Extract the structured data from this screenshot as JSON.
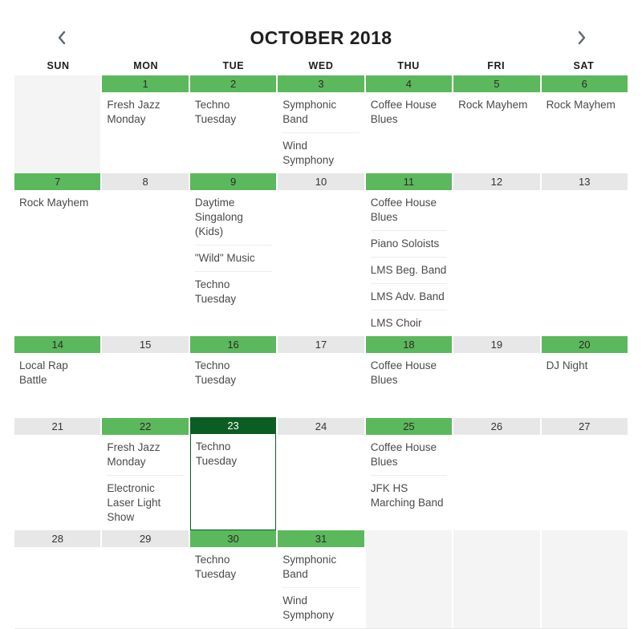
{
  "header": {
    "title": "OCTOBER 2018",
    "prev_label": "‹",
    "next_label": "›",
    "prev_icon": "chevron-left-icon",
    "next_icon": "chevron-right-icon"
  },
  "weekdays": [
    "SUN",
    "MON",
    "TUE",
    "WED",
    "THU",
    "FRI",
    "SAT"
  ],
  "colors": {
    "event_day": "#5cb85c",
    "today": "#0b5d23",
    "empty_day": "#e7e7e7",
    "outside_cell": "#f4f4f4",
    "text": "#4a4a4a"
  },
  "weeks": [
    {
      "days": [
        {
          "num": "",
          "outside": true,
          "today": false,
          "events": []
        },
        {
          "num": "1",
          "outside": false,
          "today": false,
          "events": [
            "Fresh Jazz Monday"
          ]
        },
        {
          "num": "2",
          "outside": false,
          "today": false,
          "events": [
            "Techno Tuesday"
          ]
        },
        {
          "num": "3",
          "outside": false,
          "today": false,
          "events": [
            "Symphonic Band",
            "Wind Symphony"
          ]
        },
        {
          "num": "4",
          "outside": false,
          "today": false,
          "events": [
            "Coffee House Blues"
          ]
        },
        {
          "num": "5",
          "outside": false,
          "today": false,
          "events": [
            "Rock Mayhem"
          ]
        },
        {
          "num": "6",
          "outside": false,
          "today": false,
          "events": [
            "Rock Mayhem"
          ]
        }
      ]
    },
    {
      "days": [
        {
          "num": "7",
          "outside": false,
          "today": false,
          "events": [
            "Rock Mayhem"
          ]
        },
        {
          "num": "8",
          "outside": false,
          "today": false,
          "events": []
        },
        {
          "num": "9",
          "outside": false,
          "today": false,
          "events": [
            "Daytime Singalong (Kids)",
            "\"Wild\" Music",
            "Techno Tuesday"
          ]
        },
        {
          "num": "10",
          "outside": false,
          "today": false,
          "events": []
        },
        {
          "num": "11",
          "outside": false,
          "today": false,
          "events": [
            "Coffee House Blues",
            "Piano Soloists",
            "LMS Beg. Band",
            "LMS Adv. Band",
            "LMS Choir"
          ]
        },
        {
          "num": "12",
          "outside": false,
          "today": false,
          "events": []
        },
        {
          "num": "13",
          "outside": false,
          "today": false,
          "events": []
        }
      ]
    },
    {
      "days": [
        {
          "num": "14",
          "outside": false,
          "today": false,
          "events": [
            "Local Rap Battle"
          ]
        },
        {
          "num": "15",
          "outside": false,
          "today": false,
          "events": []
        },
        {
          "num": "16",
          "outside": false,
          "today": false,
          "events": [
            "Techno Tuesday"
          ]
        },
        {
          "num": "17",
          "outside": false,
          "today": false,
          "events": []
        },
        {
          "num": "18",
          "outside": false,
          "today": false,
          "events": [
            "Coffee House Blues"
          ]
        },
        {
          "num": "19",
          "outside": false,
          "today": false,
          "events": []
        },
        {
          "num": "20",
          "outside": false,
          "today": false,
          "events": [
            "DJ Night"
          ]
        }
      ]
    },
    {
      "days": [
        {
          "num": "21",
          "outside": false,
          "today": false,
          "events": []
        },
        {
          "num": "22",
          "outside": false,
          "today": false,
          "events": [
            "Fresh Jazz Monday",
            "Electronic Laser Light Show"
          ]
        },
        {
          "num": "23",
          "outside": false,
          "today": true,
          "events": [
            "Techno Tuesday"
          ]
        },
        {
          "num": "24",
          "outside": false,
          "today": false,
          "events": []
        },
        {
          "num": "25",
          "outside": false,
          "today": false,
          "events": [
            "Coffee House Blues",
            "JFK HS Marching Band"
          ]
        },
        {
          "num": "26",
          "outside": false,
          "today": false,
          "events": []
        },
        {
          "num": "27",
          "outside": false,
          "today": false,
          "events": []
        }
      ]
    },
    {
      "days": [
        {
          "num": "28",
          "outside": false,
          "today": false,
          "events": []
        },
        {
          "num": "29",
          "outside": false,
          "today": false,
          "events": []
        },
        {
          "num": "30",
          "outside": false,
          "today": false,
          "events": [
            "Techno Tuesday"
          ]
        },
        {
          "num": "31",
          "outside": false,
          "today": false,
          "events": [
            "Symphonic Band",
            "Wind Symphony"
          ]
        },
        {
          "num": "",
          "outside": true,
          "today": false,
          "events": []
        },
        {
          "num": "",
          "outside": true,
          "today": false,
          "events": []
        },
        {
          "num": "",
          "outside": true,
          "today": false,
          "events": []
        }
      ]
    }
  ]
}
